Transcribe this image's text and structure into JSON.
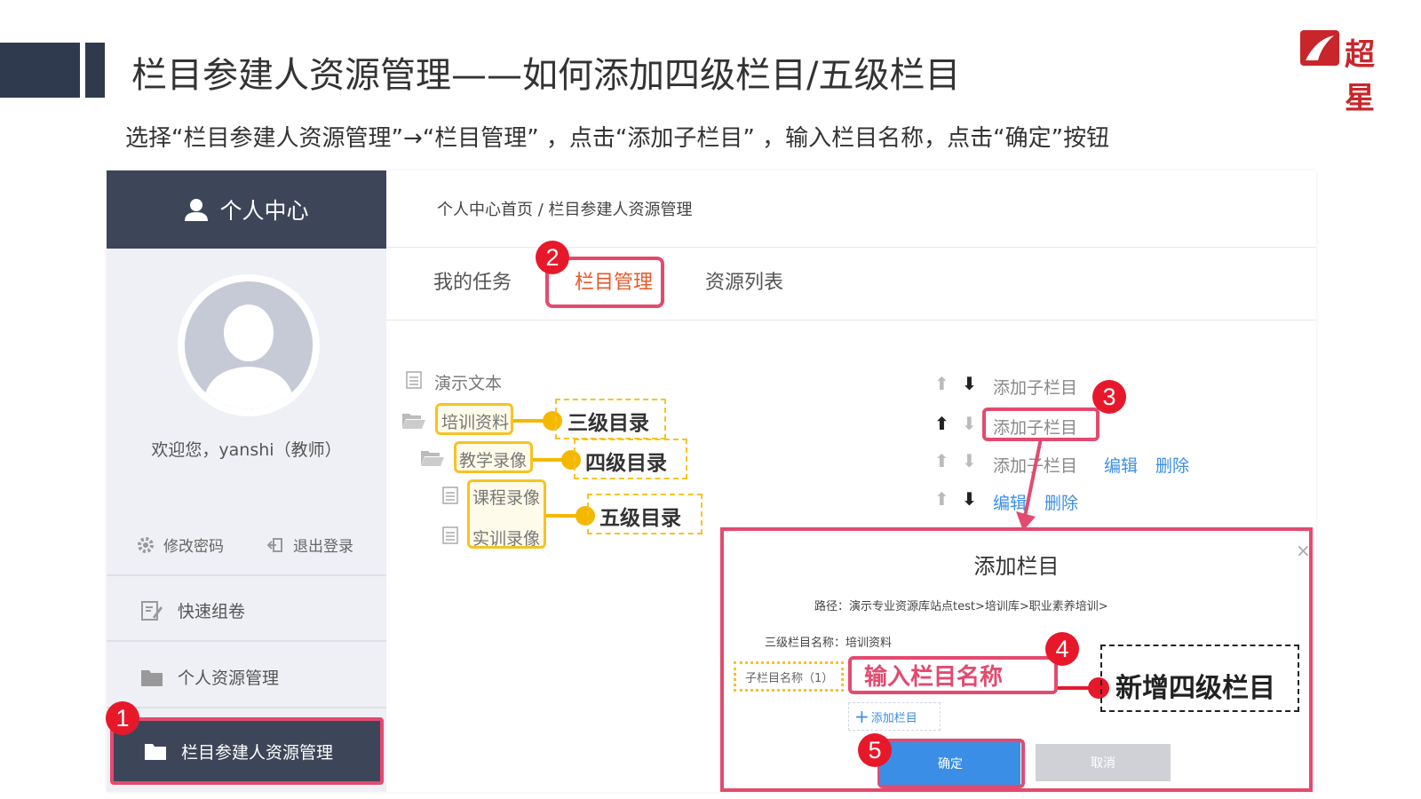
{
  "slide": {
    "title": "栏目参建人资源管理——如何添加四级栏目/五级栏目",
    "subtitle": "选择“栏目参建人资源管理”→“栏目管理” ，点击“添加子栏目” ，输入栏目名称，点击“确定”按钮",
    "logo_text": "超星"
  },
  "colors": {
    "dark": "#3d4658",
    "accent_pink": "#e34a6f",
    "badge_red": "#e8182b",
    "yellow": "#f5c325",
    "link_blue": "#3a8ee6"
  },
  "sidebar": {
    "header": "个人中心",
    "welcome": "欢迎您，yanshi（教师）",
    "change_password": "修改密码",
    "logout": "退出登录",
    "items": [
      {
        "label": "快速组卷",
        "icon": "edit-icon"
      },
      {
        "label": "个人资源管理",
        "icon": "folder-icon"
      },
      {
        "label": "栏目参建人资源管理",
        "icon": "folder-icon"
      }
    ]
  },
  "main": {
    "breadcrumb": "个人中心首页 / 栏目参建人资源管理",
    "tabs": [
      "我的任务",
      "栏目管理",
      "资源列表"
    ],
    "tree": {
      "root": "演示文本",
      "level3": "培训资料",
      "level4": "教学录像",
      "level5a": "课程录像",
      "level5b": "实训录像"
    },
    "callouts": {
      "level3": "三级目录",
      "level4": "四级目录",
      "level5": "五级目录"
    },
    "ops": {
      "add_child": "添加子栏目",
      "edit": "编辑",
      "delete": "删除"
    }
  },
  "steps": [
    "1",
    "2",
    "3",
    "4",
    "5"
  ],
  "dialog": {
    "title": "添加栏目",
    "close": "×",
    "path": "路径：演示专业资源库站点test>培训库>职业素养培训>",
    "level3_name": "三级栏目名称：培训资料",
    "child_label": "子栏目名称（1）",
    "input_hint": "输入栏目名称",
    "add_column": "添加栏目",
    "ok": "确定",
    "cancel": "取消",
    "callout": "新增四级栏目"
  }
}
